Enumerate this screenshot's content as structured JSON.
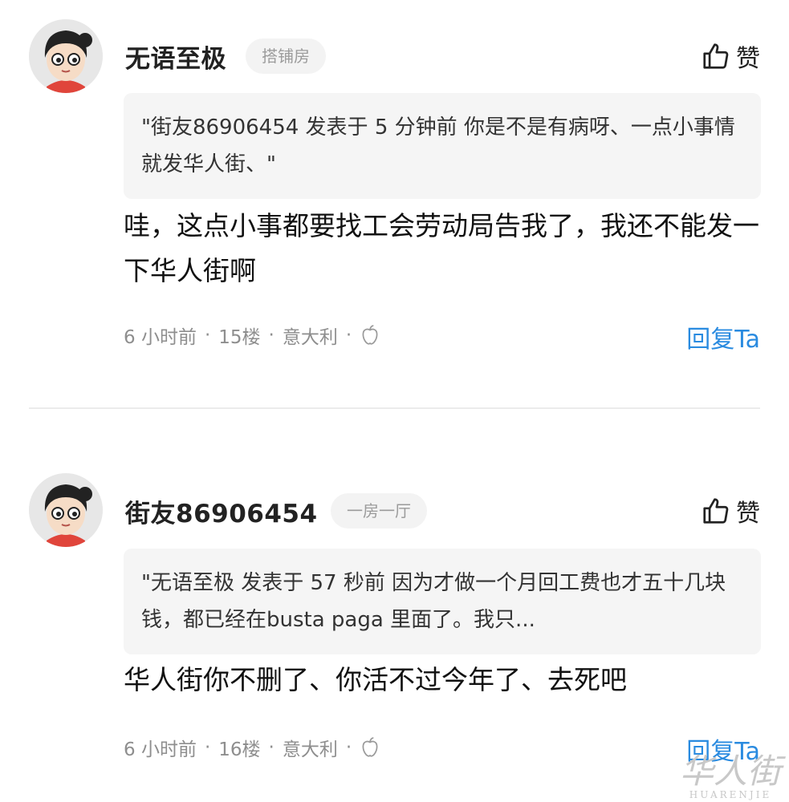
{
  "comments": [
    {
      "username": "无语至极",
      "badge": "搭铺房",
      "like_label": "赞",
      "quote": "\"街友86906454 发表于 5 分钟前 你是不是有病呀、一点小事情就发华人街、\"",
      "body": "哇，这点小事都要找工会劳动局告我了，我还不能发一下华人街啊",
      "time": "6 小时前",
      "floor": "15楼",
      "location": "意大利",
      "device_icon": "apple-icon",
      "reply_label": "回复Ta"
    },
    {
      "username": "街友86906454",
      "badge": "一房一厅",
      "like_label": "赞",
      "quote": "\"无语至极 发表于 57 秒前 因为才做一个月回工费也才五十几块钱，都已经在busta paga 里面了。我只...",
      "body": "华人街你不删了、你活不过今年了、去死吧",
      "time": "6 小时前",
      "floor": "16楼",
      "location": "意大利",
      "device_icon": "apple-icon",
      "reply_label": "回复Ta"
    }
  ],
  "meta_separator": "·",
  "watermark": {
    "main": "华人街",
    "sub": "HUARENJIE"
  },
  "colors": {
    "accent": "#2a8be0",
    "meta_text": "#8e8e8e",
    "quote_bg": "#f5f5f5",
    "badge_bg": "#f3f3f3"
  }
}
